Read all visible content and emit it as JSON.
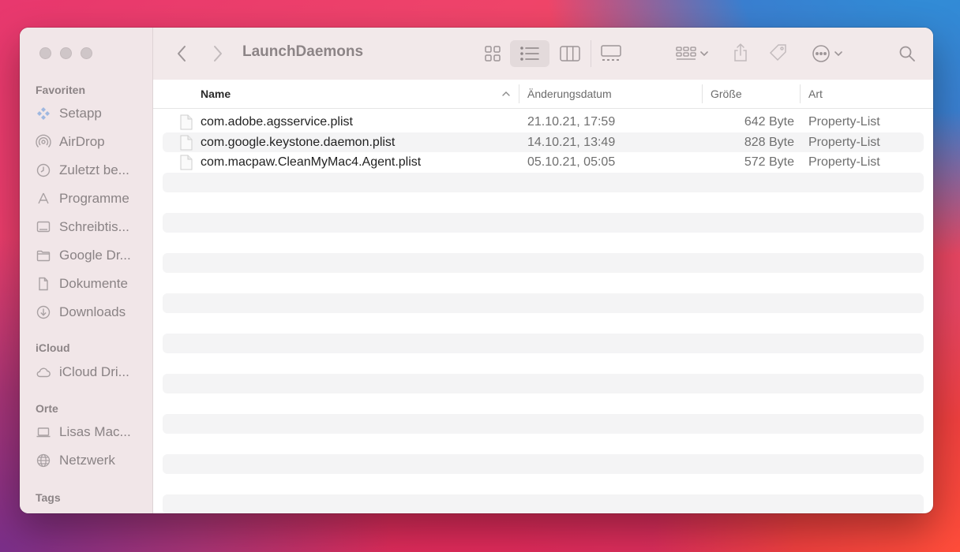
{
  "window": {
    "title": "LaunchDaemons"
  },
  "sidebar": {
    "sections": [
      {
        "label": "Favoriten"
      },
      {
        "label": "iCloud"
      },
      {
        "label": "Orte"
      },
      {
        "label": "Tags"
      }
    ],
    "favorites": [
      {
        "label": "Setapp",
        "icon": "setapp-icon"
      },
      {
        "label": "AirDrop",
        "icon": "airdrop-icon"
      },
      {
        "label": "Zuletzt be...",
        "icon": "clock-icon"
      },
      {
        "label": "Programme",
        "icon": "apps-icon"
      },
      {
        "label": "Schreibtis...",
        "icon": "desktop-icon"
      },
      {
        "label": "Google Dr...",
        "icon": "folder-icon"
      },
      {
        "label": "Dokumente",
        "icon": "document-icon"
      },
      {
        "label": "Downloads",
        "icon": "download-icon"
      }
    ],
    "icloud": [
      {
        "label": "iCloud Dri...",
        "icon": "cloud-icon"
      }
    ],
    "locations": [
      {
        "label": "Lisas Mac...",
        "icon": "laptop-icon"
      },
      {
        "label": "Netzwerk",
        "icon": "globe-icon"
      }
    ]
  },
  "columns": {
    "name": "Name",
    "date": "Änderungsdatum",
    "size": "Größe",
    "kind": "Art"
  },
  "files": [
    {
      "name": "com.adobe.agsservice.plist",
      "date": "21.10.21, 17:59",
      "size": "642 Byte",
      "kind": "Property-List"
    },
    {
      "name": "com.google.keystone.daemon.plist",
      "date": "14.10.21, 13:49",
      "size": "828 Byte",
      "kind": "Property-List"
    },
    {
      "name": "com.macpaw.CleanMyMac4.Agent.plist",
      "date": "05.10.21, 05:05",
      "size": "572 Byte",
      "kind": "Property-List"
    }
  ]
}
